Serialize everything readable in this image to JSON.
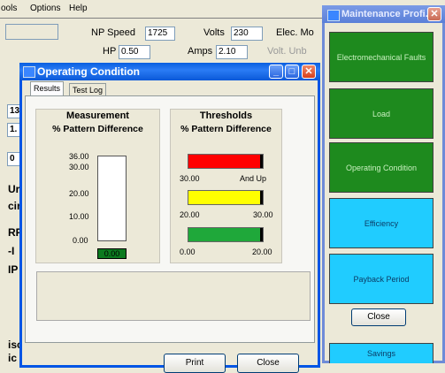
{
  "background_window": {
    "menu": [
      "ools",
      "Options",
      "Help"
    ],
    "labels": {
      "np_speed": "NP Speed",
      "volts": "Volts",
      "elec": "Elec. Mo",
      "hp": "HP",
      "amps": "Amps",
      "volt_unb": "Volt. Unb"
    },
    "values": {
      "np_speed": "1725",
      "volts": "230",
      "hp": "0.50",
      "amps": "2.10"
    },
    "left_edge": [
      "13",
      "1.",
      "0",
      "Ur",
      "cin",
      "RP",
      "-I",
      "IP",
      "isc",
      "ic"
    ]
  },
  "dialog": {
    "title": "Operating Condition",
    "tabs": [
      "Results",
      "Test Log"
    ],
    "measurement": {
      "heading": "Measurement",
      "subheading": "% Pattern Difference",
      "ticks": [
        "36.00",
        "30.00",
        "20.00",
        "10.00",
        "0.00"
      ],
      "value": 0.0,
      "value_label": "0.00",
      "max": 36.0
    },
    "thresholds": {
      "heading": "Thresholds",
      "subheading": "% Pattern Difference",
      "red": {
        "low": "30.00",
        "high": "And Up",
        "color": "#ff0000"
      },
      "yellow": {
        "low": "20.00",
        "high": "30.00",
        "color": "#ffff00"
      },
      "green": {
        "low": "0.00",
        "high": "20.00",
        "color": "#1fa83a"
      }
    },
    "buttons": {
      "print": "Print",
      "close": "Close"
    }
  },
  "right_panel": {
    "title": "Maintenance Profi...",
    "buttons": [
      {
        "label": "Electromechanical Faults",
        "color": "green"
      },
      {
        "label": "Load",
        "color": "green"
      },
      {
        "label": "Operating Condition",
        "color": "green"
      },
      {
        "label": "Efficiency",
        "color": "cyan"
      },
      {
        "label": "Payback Period",
        "color": "cyan"
      }
    ],
    "close_label": "Close",
    "bottom_label": "Savings"
  }
}
